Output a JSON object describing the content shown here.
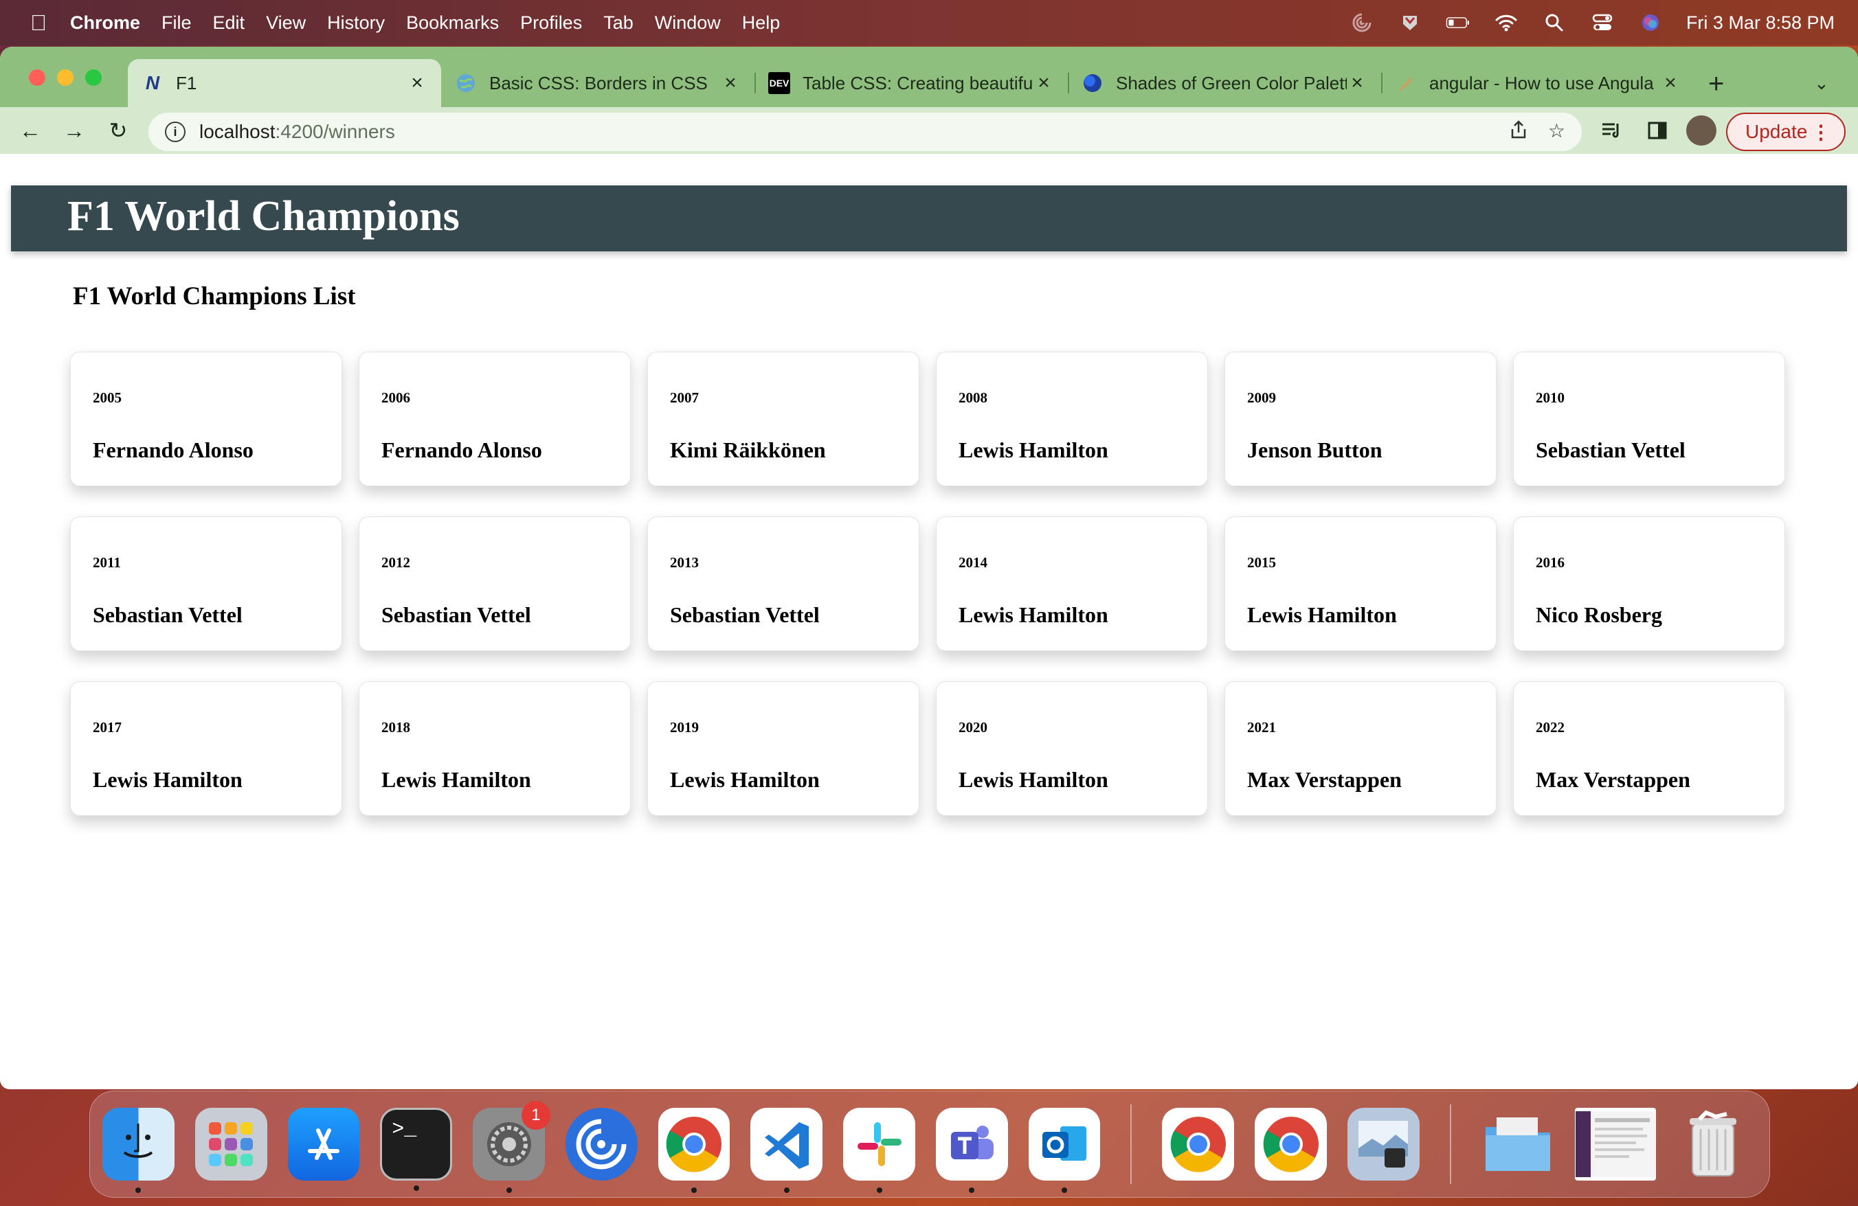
{
  "menubar": {
    "app": "Chrome",
    "items": [
      "File",
      "Edit",
      "View",
      "History",
      "Bookmarks",
      "Profiles",
      "Tab",
      "Window",
      "Help"
    ],
    "clock": "Fri 3 Mar  8:58 PM"
  },
  "tabs": [
    {
      "title": "F1",
      "favicon": "angular-n-icon",
      "active": true
    },
    {
      "title": "Basic CSS: Borders in CSS",
      "favicon": "globe-icon",
      "active": false
    },
    {
      "title": "Table CSS: Creating beautifu",
      "favicon": "dev-icon",
      "active": false
    },
    {
      "title": "Shades of Green Color Palett",
      "favicon": "palette-icon",
      "active": false
    },
    {
      "title": "angular - How to use Angula",
      "favicon": "stackoverflow-icon",
      "active": false
    }
  ],
  "tab_favicon_text": {
    "f1": "N",
    "dev": "DEV"
  },
  "omnibox": {
    "host": "localhost",
    "path": ":4200/winners"
  },
  "update_label": "Update",
  "page": {
    "title": "F1 World Champions",
    "subtitle": "F1 World Champions List"
  },
  "champions": [
    {
      "year": "2005",
      "name": "Fernando Alonso"
    },
    {
      "year": "2006",
      "name": "Fernando Alonso"
    },
    {
      "year": "2007",
      "name": "Kimi Räikkönen"
    },
    {
      "year": "2008",
      "name": "Lewis Hamilton"
    },
    {
      "year": "2009",
      "name": "Jenson Button"
    },
    {
      "year": "2010",
      "name": "Sebastian Vettel"
    },
    {
      "year": "2011",
      "name": "Sebastian Vettel"
    },
    {
      "year": "2012",
      "name": "Sebastian Vettel"
    },
    {
      "year": "2013",
      "name": "Sebastian Vettel"
    },
    {
      "year": "2014",
      "name": "Lewis Hamilton"
    },
    {
      "year": "2015",
      "name": "Lewis Hamilton"
    },
    {
      "year": "2016",
      "name": "Nico Rosberg"
    },
    {
      "year": "2017",
      "name": "Lewis Hamilton"
    },
    {
      "year": "2018",
      "name": "Lewis Hamilton"
    },
    {
      "year": "2019",
      "name": "Lewis Hamilton"
    },
    {
      "year": "2020",
      "name": "Lewis Hamilton"
    },
    {
      "year": "2021",
      "name": "Max Verstappen"
    },
    {
      "year": "2022",
      "name": "Max Verstappen"
    }
  ],
  "dock": {
    "apps": [
      {
        "name": "finder-icon",
        "color": "#3aa0f0"
      },
      {
        "name": "launchpad-icon",
        "color": "#9aa0aa"
      },
      {
        "name": "app-store-icon",
        "color": "#1e88f5"
      },
      {
        "name": "terminal-icon",
        "color": "#222222"
      },
      {
        "name": "system-settings-icon",
        "color": "#8a8a8a",
        "badge": "1"
      },
      {
        "name": "azure-data-studio-icon",
        "color": "#2a6fdb"
      },
      {
        "name": "chrome-icon",
        "color": "#ffffff"
      },
      {
        "name": "vscode-icon",
        "color": "#ffffff"
      },
      {
        "name": "slack-icon",
        "color": "#ffffff"
      },
      {
        "name": "teams-icon",
        "color": "#ffffff"
      },
      {
        "name": "outlook-icon",
        "color": "#ffffff"
      }
    ],
    "recent": [
      {
        "name": "chrome-icon",
        "color": "#ffffff"
      },
      {
        "name": "chrome-icon",
        "color": "#ffffff"
      },
      {
        "name": "preview-icon",
        "color": "#b8c8dc"
      }
    ],
    "stacks": [
      {
        "name": "folder-icon",
        "color": "#7ec0f0"
      },
      {
        "name": "screenshot-stack-icon",
        "color": "#4a3a5a"
      },
      {
        "name": "trash-icon",
        "color": "#dcdcdc"
      }
    ]
  }
}
